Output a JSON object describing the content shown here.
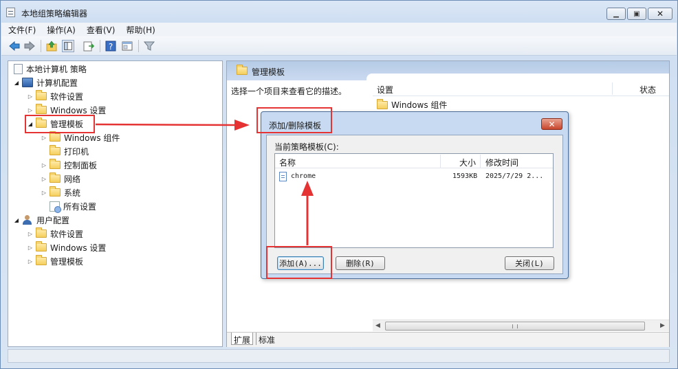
{
  "window": {
    "title": "本地组策略编辑器"
  },
  "menu": [
    "文件(F)",
    "操作(A)",
    "查看(V)",
    "帮助(H)"
  ],
  "toolbar": {
    "icons": [
      "back-arrow-icon",
      "forward-arrow-icon",
      "up-folder-icon",
      "show-hide-tree-icon",
      "export-list-icon",
      "help-icon",
      "properties-icon",
      "filter-icon"
    ]
  },
  "tree": {
    "root": "本地计算机 策略",
    "computer_config": "计算机配置",
    "cc_software": "软件设置",
    "cc_windows": "Windows 设置",
    "cc_admin": "管理模板",
    "cc_admin_windows_components": "Windows 组件",
    "cc_admin_printers": "打印机",
    "cc_admin_control_panel": "控制面板",
    "cc_admin_network": "网络",
    "cc_admin_system": "系统",
    "cc_admin_all_settings": "所有设置",
    "user_config": "用户配置",
    "uc_software": "软件设置",
    "uc_windows": "Windows 设置",
    "uc_admin": "管理模板"
  },
  "right": {
    "header_title": "管理模板",
    "description": "选择一个项目来查看它的描述。",
    "col_settings": "设置",
    "col_status": "状态",
    "row_windows_components": "Windows 组件",
    "tab_extended": "扩展",
    "tab_standard": "标准"
  },
  "dialog": {
    "title": "添加/删除模板",
    "close_glyph": "✕",
    "current_label": "当前策略模板(C):",
    "col_name": "名称",
    "col_size": "大小",
    "col_modified": "修改时间",
    "rows": [
      {
        "name": "chrome",
        "size": "1593KB",
        "modified": "2025/7/29 2..."
      }
    ],
    "btn_add": "添加(A)...",
    "btn_delete": "删除(R)",
    "btn_close": "关闭(L)"
  },
  "colors": {
    "highlight_red": "#e53333",
    "title_blue": "#c7daf1"
  }
}
